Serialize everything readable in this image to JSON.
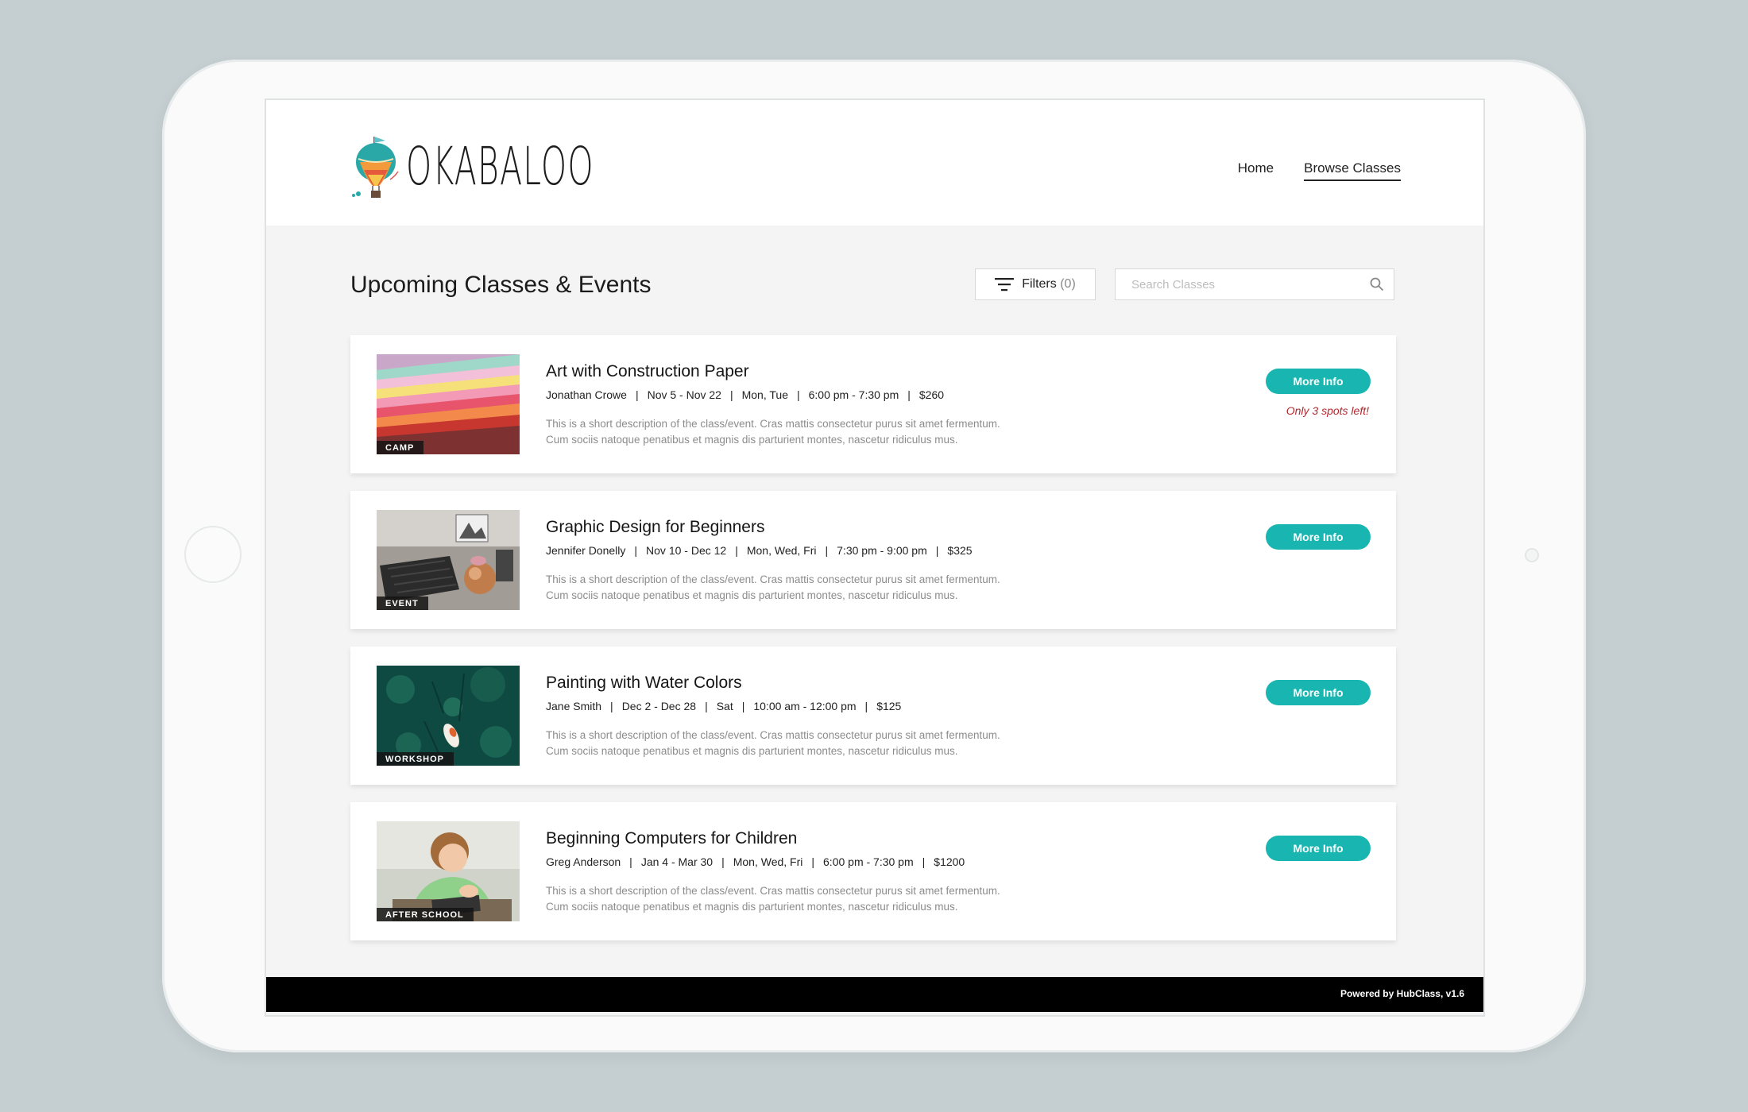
{
  "brand": {
    "name": "OKABALOO"
  },
  "nav": {
    "items": [
      "Home",
      "Browse Classes"
    ],
    "active": "Browse Classes"
  },
  "page": {
    "title": "Upcoming Classes & Events"
  },
  "filters": {
    "label": "Filters",
    "count": "(0)"
  },
  "search": {
    "placeholder": "Search Classes"
  },
  "classes": [
    {
      "title": "Art with Construction Paper",
      "instructor": "Jonathan Crowe",
      "dates": "Nov 5 - Nov 22",
      "days": "Mon, Tue",
      "time": "6:00 pm - 7:30 pm",
      "price": "$260",
      "category": "CAMP",
      "description_line1": "This is a short description of the class/event. Cras mattis consectetur purus sit amet fermentum.",
      "description_line2": "Cum sociis natoque penatibus et magnis dis parturient montes, nascetur ridiculus mus.",
      "button": "More Info",
      "note": "Only 3 spots left!"
    },
    {
      "title": "Graphic Design for Beginners",
      "instructor": "Jennifer Donelly",
      "dates": "Nov 10 - Dec 12",
      "days": "Mon, Wed, Fri",
      "time": "7:30 pm - 9:00 pm",
      "price": "$325",
      "category": "EVENT",
      "description_line1": "This is a short description of the class/event. Cras mattis consectetur purus sit amet fermentum.",
      "description_line2": "Cum sociis natoque penatibus et magnis dis parturient montes, nascetur ridiculus mus.",
      "button": "More Info"
    },
    {
      "title": "Painting with Water Colors",
      "instructor": "Jane Smith",
      "dates": "Dec 2 - Dec 28",
      "days": "Sat",
      "time": "10:00 am - 12:00 pm",
      "price": "$125",
      "category": "WORKSHOP",
      "description_line1": "This is a short description of the class/event. Cras mattis consectetur purus sit amet fermentum.",
      "description_line2": "Cum sociis natoque penatibus et magnis dis parturient montes, nascetur ridiculus mus.",
      "button": "More Info"
    },
    {
      "title": "Beginning Computers for Children",
      "instructor": "Greg Anderson",
      "dates": "Jan 4 - Mar 30",
      "days": "Mon, Wed, Fri",
      "time": "6:00 pm - 7:30 pm",
      "price": "$1200",
      "category": "AFTER SCHOOL",
      "description_line1": "This is a short description of the class/event. Cras mattis consectetur purus sit amet fermentum.",
      "description_line2": "Cum sociis natoque penatibus et magnis dis parturient montes, nascetur ridiculus mus.",
      "button": "More Info"
    }
  ],
  "footer": {
    "text": "Powered by HubClass, v1.6"
  },
  "colors": {
    "accent": "#19b6b1",
    "alert": "#b0282f",
    "footer_bg": "#000000"
  },
  "icons": [
    "hot-air-balloon-logo-icon",
    "filter-icon",
    "search-icon"
  ]
}
